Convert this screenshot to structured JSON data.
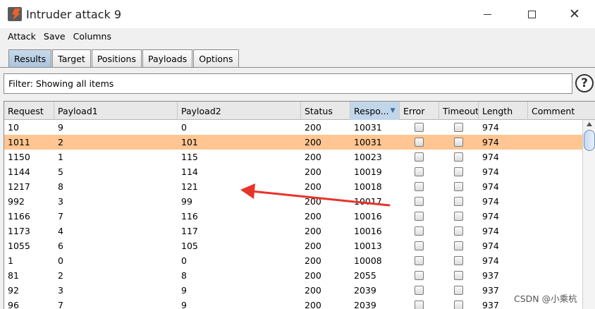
{
  "window": {
    "title": "Intruder attack 9"
  },
  "menu": [
    "Attack",
    "Save",
    "Columns"
  ],
  "tabs": [
    "Results",
    "Target",
    "Positions",
    "Payloads",
    "Options"
  ],
  "active_tab": "Results",
  "filter": {
    "text": "Filter: Showing all items"
  },
  "help_label": "?",
  "table": {
    "columns": [
      "Request",
      "Payload1",
      "Payload2",
      "Status",
      "Respo...",
      "Error",
      "Timeout",
      "Length",
      "Comment"
    ],
    "sorted_column": "Respo...",
    "rows": [
      {
        "request": "10",
        "payload1": "9",
        "payload2": "0",
        "status": "200",
        "response": "10031",
        "error": false,
        "timeout": false,
        "length": "974",
        "comment": "",
        "selected": false
      },
      {
        "request": "1011",
        "payload1": "2",
        "payload2": "101",
        "status": "200",
        "response": "10031",
        "error": false,
        "timeout": false,
        "length": "974",
        "comment": "",
        "selected": true
      },
      {
        "request": "1150",
        "payload1": "1",
        "payload2": "115",
        "status": "200",
        "response": "10023",
        "error": false,
        "timeout": false,
        "length": "974",
        "comment": "",
        "selected": false
      },
      {
        "request": "1144",
        "payload1": "5",
        "payload2": "114",
        "status": "200",
        "response": "10019",
        "error": false,
        "timeout": false,
        "length": "974",
        "comment": "",
        "selected": false
      },
      {
        "request": "1217",
        "payload1": "8",
        "payload2": "121",
        "status": "200",
        "response": "10018",
        "error": false,
        "timeout": false,
        "length": "974",
        "comment": "",
        "selected": false
      },
      {
        "request": "992",
        "payload1": "3",
        "payload2": "99",
        "status": "200",
        "response": "10017",
        "error": false,
        "timeout": false,
        "length": "974",
        "comment": "",
        "selected": false
      },
      {
        "request": "1166",
        "payload1": "7",
        "payload2": "116",
        "status": "200",
        "response": "10016",
        "error": false,
        "timeout": false,
        "length": "974",
        "comment": "",
        "selected": false
      },
      {
        "request": "1173",
        "payload1": "4",
        "payload2": "117",
        "status": "200",
        "response": "10016",
        "error": false,
        "timeout": false,
        "length": "974",
        "comment": "",
        "selected": false
      },
      {
        "request": "1055",
        "payload1": "6",
        "payload2": "105",
        "status": "200",
        "response": "10013",
        "error": false,
        "timeout": false,
        "length": "974",
        "comment": "",
        "selected": false
      },
      {
        "request": "1",
        "payload1": "0",
        "payload2": "0",
        "status": "200",
        "response": "10008",
        "error": false,
        "timeout": false,
        "length": "974",
        "comment": "",
        "selected": false
      },
      {
        "request": "81",
        "payload1": "2",
        "payload2": "8",
        "status": "200",
        "response": "2055",
        "error": false,
        "timeout": false,
        "length": "937",
        "comment": "",
        "selected": false
      },
      {
        "request": "92",
        "payload1": "3",
        "payload2": "9",
        "status": "200",
        "response": "2039",
        "error": false,
        "timeout": false,
        "length": "937",
        "comment": "",
        "selected": false
      },
      {
        "request": "96",
        "payload1": "7",
        "payload2": "9",
        "status": "200",
        "response": "2039",
        "error": false,
        "timeout": false,
        "length": "937",
        "comment": "",
        "selected": false
      }
    ]
  },
  "colors": {
    "selected_row": "#ffc592",
    "annotation_arrow": "#e8332a",
    "active_tab": "#b8cfe6"
  },
  "icons": {
    "app": "burp-logo-icon",
    "help": "help-icon",
    "minimize": "minimize-icon",
    "maximize": "maximize-icon",
    "close": "close-icon"
  },
  "watermark": "CSDN @小乘杭"
}
